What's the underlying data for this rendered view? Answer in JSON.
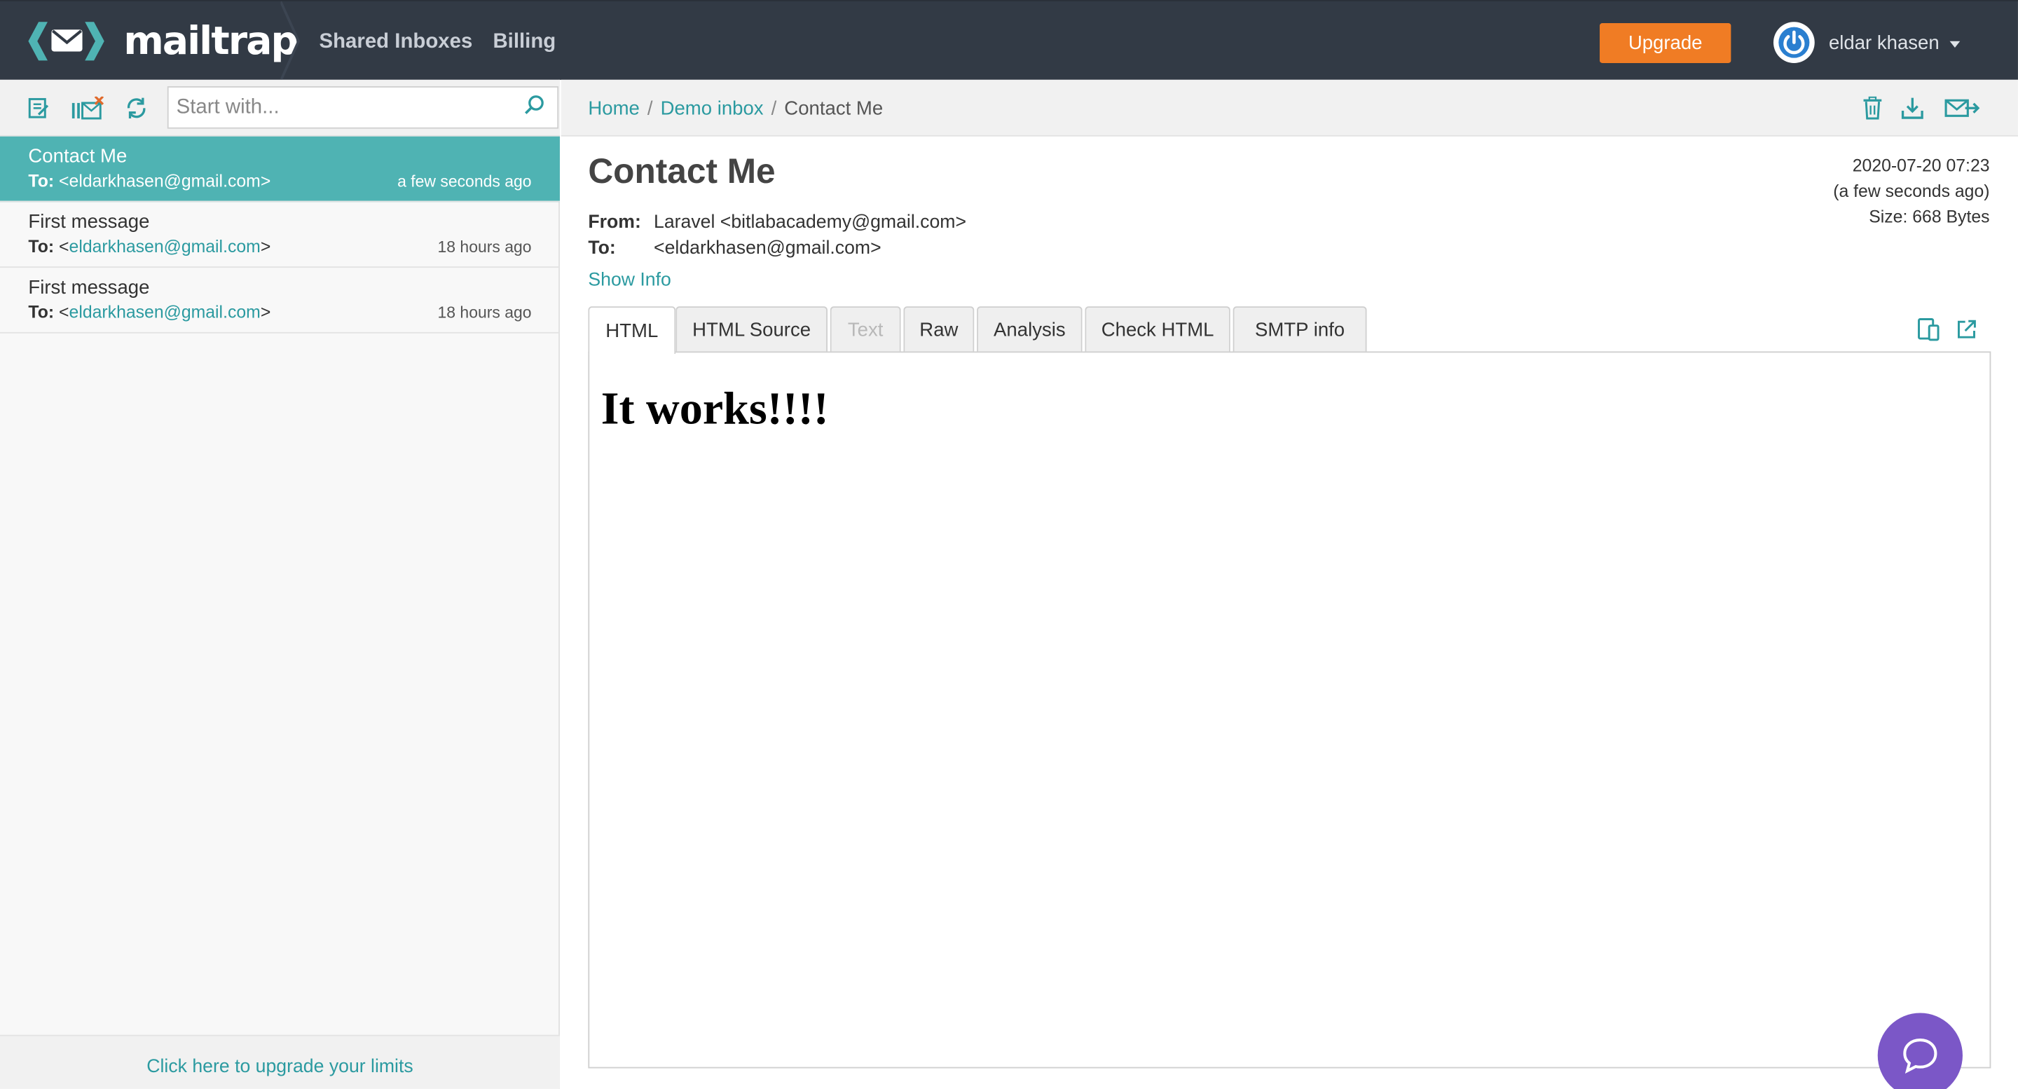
{
  "header": {
    "logo_text": "mailtrap",
    "nav": [
      "Shared Inboxes",
      "Billing"
    ],
    "upgrade_label": "Upgrade",
    "user_name": "eldar khasen",
    "colors": {
      "bar": "#323a45",
      "upgrade": "#f07c24",
      "accent": "#4fb3b3"
    }
  },
  "sidebar": {
    "search_placeholder": "Start with...",
    "messages": [
      {
        "subject": "Contact Me",
        "to_label": "To:",
        "to_prefix": "<",
        "email": "eldarkhasen@gmail.com",
        "to_suffix": ">",
        "time": "a few seconds ago",
        "active": true
      },
      {
        "subject": "First message",
        "to_label": "To:",
        "to_prefix": "<",
        "email": "eldarkhasen@gmail.com",
        "to_suffix": ">",
        "time": "18 hours ago",
        "active": false
      },
      {
        "subject": "First message",
        "to_label": "To:",
        "to_prefix": "<",
        "email": "eldarkhasen@gmail.com",
        "to_suffix": ">",
        "time": "18 hours ago",
        "active": false
      }
    ],
    "footer_link": "Click here to upgrade your limits"
  },
  "main": {
    "breadcrumb": [
      "Home",
      "Demo inbox",
      "Contact Me"
    ],
    "subject": "Contact Me",
    "from_label": "From:",
    "from_value": "Laravel <bitlabacademy@gmail.com>",
    "to_label": "To:",
    "to_value": "<eldarkhasen@gmail.com>",
    "show_info": "Show Info",
    "date": "2020-07-20 07:23",
    "relative_time": "(a few seconds ago)",
    "size": "Size: 668 Bytes",
    "tabs": [
      "HTML",
      "HTML Source",
      "Text",
      "Raw",
      "Analysis",
      "Check HTML",
      "SMTP info"
    ],
    "preview_heading": "It works!!!!"
  }
}
